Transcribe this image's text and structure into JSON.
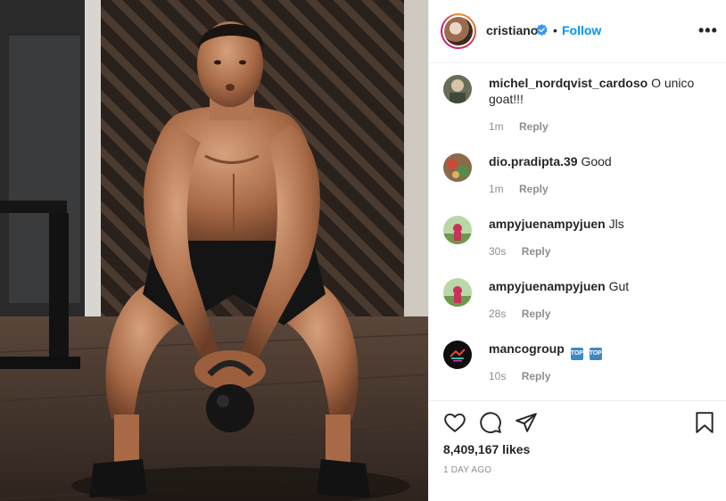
{
  "post": {
    "image_alt": "Shirtless athlete doing a kettlebell swing in a gym",
    "username": "cristiano",
    "separator": "•",
    "follow_label": "Follow",
    "more_label": "•••"
  },
  "comments": [
    {
      "user": "michel_nordqvist_cardoso",
      "text": "O unico goat!!!",
      "time": "1m",
      "reply": "Reply"
    },
    {
      "user": "dio.pradipta.39",
      "text": "Good",
      "time": "1m",
      "reply": "Reply"
    },
    {
      "user": "ampyjuenampyjuen",
      "text": "Jls",
      "time": "30s",
      "reply": "Reply"
    },
    {
      "user": "ampyjuenampyjuen",
      "text": "Gut",
      "time": "28s",
      "reply": "Reply"
    },
    {
      "user": "mancogroup",
      "text": "",
      "time": "10s",
      "reply": "Reply",
      "emojis": [
        "TOP",
        "TOP"
      ]
    }
  ],
  "footer": {
    "likes": "8,409,167 likes",
    "date": "1 DAY AGO"
  },
  "colors": {
    "link": "#0095f6",
    "verified": "#3897f0",
    "muted": "#8e8e8e",
    "text": "#262626"
  }
}
